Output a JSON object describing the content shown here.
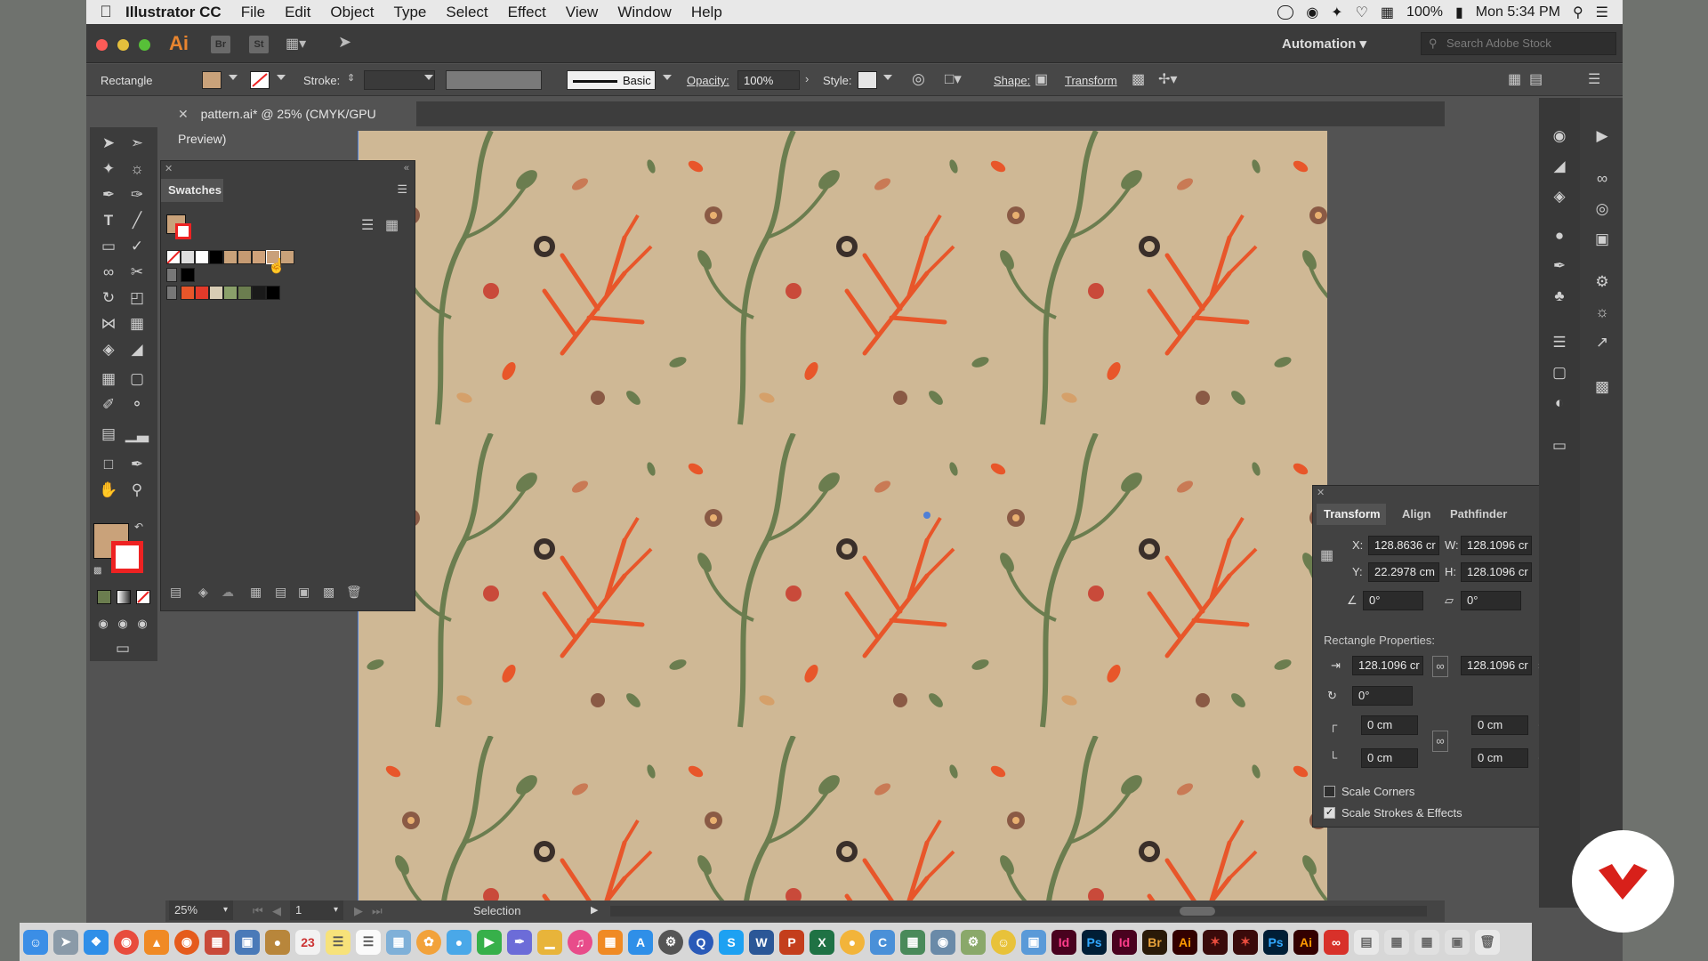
{
  "menubar": {
    "app": "Illustrator CC",
    "items": [
      "File",
      "Edit",
      "Object",
      "Type",
      "Select",
      "Effect",
      "View",
      "Window",
      "Help"
    ],
    "battery": "100%",
    "clock": "Mon 5:34 PM"
  },
  "appbar": {
    "logo": "Ai",
    "bridge": "Br",
    "stock": "St",
    "workspace": "Automation",
    "search_placeholder": "Search Adobe Stock"
  },
  "control": {
    "object_type": "Rectangle",
    "stroke_label": "Stroke:",
    "brush": "Basic",
    "opacity_label": "Opacity:",
    "opacity": "100%",
    "style_label": "Style:",
    "shape_label": "Shape:",
    "transform_label": "Transform"
  },
  "document": {
    "tab": "pattern.ai* @ 25% (CMYK/GPU Preview)"
  },
  "swatches": {
    "title": "Swatches"
  },
  "transform": {
    "tabs": [
      "Transform",
      "Align",
      "Pathfinder"
    ],
    "x_label": "X:",
    "x": "128.8636 cr",
    "w_label": "W:",
    "w": "128.1096 cr",
    "y_label": "Y:",
    "y": "22.2978 cm",
    "h_label": "H:",
    "h": "128.1096 cr",
    "angle": "0°",
    "shear": "0°",
    "rect_props": "Rectangle Properties:",
    "rect_w": "128.1096 cr",
    "rect_h": "128.1096 cr",
    "rect_angle": "0°",
    "corner_tl": "0 cm",
    "corner_tr": "0 cm",
    "corner_bl": "0 cm",
    "corner_br": "0 cm",
    "scale_corners": "Scale Corners",
    "scale_strokes": "Scale Strokes & Effects"
  },
  "status": {
    "zoom": "25%",
    "artboard": "1",
    "tool": "Selection"
  },
  "colors": {
    "canvas": "#cfb895",
    "orange": "#e8562a",
    "green": "#6b7d4f",
    "dark": "#3a2f2a"
  }
}
